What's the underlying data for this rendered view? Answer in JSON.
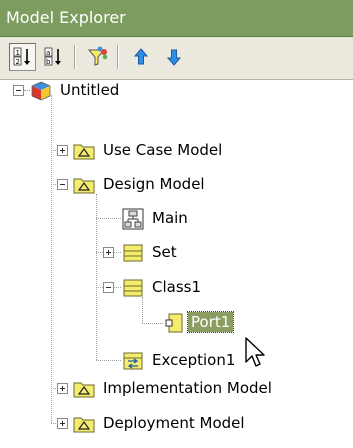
{
  "window": {
    "title": "Model Explorer"
  },
  "toolbar": {
    "buttons": [
      {
        "icon": "sort-numeric-ascending-icon",
        "pressed": true
      },
      {
        "icon": "sort-alphabetic-ascending-icon",
        "pressed": false
      },
      {
        "icon": "filter-icon",
        "pressed": false
      },
      {
        "icon": "move-up-arrow-icon",
        "pressed": false
      },
      {
        "icon": "move-down-arrow-icon",
        "pressed": false
      }
    ]
  },
  "tree": {
    "root": {
      "label": "Untitled",
      "icon": "project-cube-icon",
      "expanded": true
    },
    "models": [
      {
        "label": "Use Case Model",
        "icon": "model-folder-icon",
        "expanded": false
      },
      {
        "label": "Design Model",
        "icon": "model-folder-icon",
        "expanded": true,
        "children": [
          {
            "label": "Main",
            "icon": "diagram-icon"
          },
          {
            "label": "Set",
            "icon": "class-icon",
            "expanded": false
          },
          {
            "label": "Class1",
            "icon": "class-icon",
            "expanded": true,
            "children": [
              {
                "label": "Port1",
                "icon": "port-icon",
                "selected": true
              }
            ]
          },
          {
            "label": "Exception1",
            "icon": "exception-icon"
          }
        ]
      },
      {
        "label": "Implementation Model",
        "icon": "model-folder-icon",
        "expanded": false
      },
      {
        "label": "Deployment Model",
        "icon": "model-folder-icon",
        "expanded": false
      }
    ]
  },
  "colors": {
    "titlebar": "#7c9d5f",
    "toolbar": "#ebe9de",
    "selection": "#8c9d62",
    "folder": "#f5eb6e",
    "arrow_blue": "#2f8fe8"
  }
}
